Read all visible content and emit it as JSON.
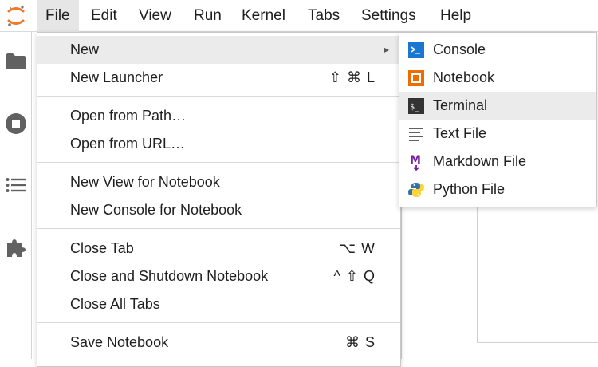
{
  "menubar": {
    "items": [
      {
        "label": "File"
      },
      {
        "label": "Edit"
      },
      {
        "label": "View"
      },
      {
        "label": "Run"
      },
      {
        "label": "Kernel"
      },
      {
        "label": "Tabs"
      },
      {
        "label": "Settings"
      },
      {
        "label": "Help"
      }
    ]
  },
  "sidebar": {
    "icons": [
      "folder-icon",
      "stop-circle-icon",
      "list-icon",
      "puzzle-icon"
    ]
  },
  "file_menu": {
    "items": [
      {
        "label": "New",
        "shortcut": "",
        "has_submenu": true
      },
      {
        "label": "New Launcher",
        "shortcut": "⇧ ⌘ L"
      },
      {
        "label": "Open from Path…",
        "shortcut": ""
      },
      {
        "label": "Open from URL…",
        "shortcut": ""
      },
      {
        "label": "New View for Notebook",
        "shortcut": ""
      },
      {
        "label": "New Console for Notebook",
        "shortcut": ""
      },
      {
        "label": "Close Tab",
        "shortcut": "⌥ W"
      },
      {
        "label": "Close and Shutdown Notebook",
        "shortcut": "^ ⇧ Q"
      },
      {
        "label": "Close All Tabs",
        "shortcut": ""
      },
      {
        "label": "Save Notebook",
        "shortcut": "⌘ S"
      }
    ],
    "submenu_arrow": "▸"
  },
  "new_submenu": {
    "items": [
      {
        "label": "Console",
        "icon": "console-icon"
      },
      {
        "label": "Notebook",
        "icon": "notebook-icon"
      },
      {
        "label": "Terminal",
        "icon": "terminal-icon"
      },
      {
        "label": "Text File",
        "icon": "text-file-icon"
      },
      {
        "label": "Markdown File",
        "icon": "markdown-icon"
      },
      {
        "label": "Python File",
        "icon": "python-icon"
      }
    ]
  },
  "colors": {
    "jupyter_orange": "#f37726",
    "console_blue": "#1976d2",
    "notebook_orange": "#ef6c00",
    "markdown_purple": "#7b1fa2",
    "python_blue": "#3572a5",
    "python_yellow": "#ffd43b"
  }
}
